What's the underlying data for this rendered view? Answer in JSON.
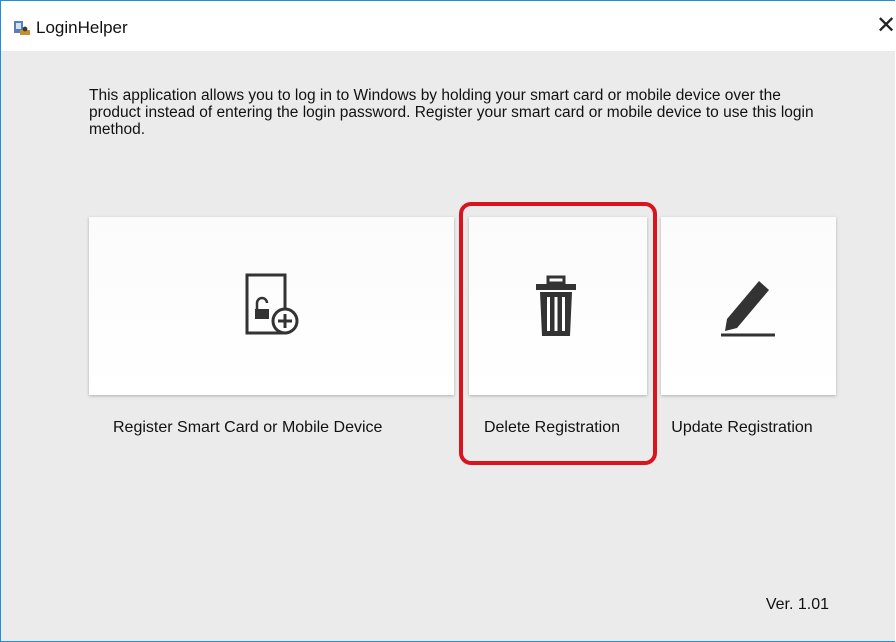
{
  "window": {
    "title": "LoginHelper",
    "app_icon": "computer-user-icon",
    "close_glyph": "✕"
  },
  "intro_text": "This application allows you to log in to Windows by holding your smart card or mobile device over the product instead of entering the login password. Register your smart card or mobile device to use this login method.",
  "actions": [
    {
      "label": "Register Smart Card or Mobile Device",
      "icon": "card-unlock-add-icon"
    },
    {
      "label": "Delete Registration",
      "icon": "trash-icon",
      "highlighted": true
    },
    {
      "label": "Update Registration",
      "icon": "pencil-edit-icon"
    }
  ],
  "highlight_color": "#d9141e",
  "version": "Ver. 1.01"
}
